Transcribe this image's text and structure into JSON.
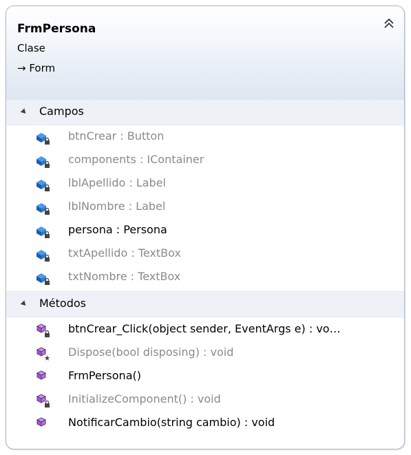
{
  "class_box": {
    "name": "FrmPersona",
    "kind": "Clase",
    "base": "→ Form"
  },
  "fields_section": {
    "label": "Campos",
    "items": [
      {
        "text": "btnCrear : Button",
        "style": "grey"
      },
      {
        "text": "components : IContainer",
        "style": "grey"
      },
      {
        "text": "lblApellido : Label",
        "style": "grey"
      },
      {
        "text": "lblNombre : Label",
        "style": "grey"
      },
      {
        "text": "persona : Persona",
        "style": "dark"
      },
      {
        "text": "txtApellido : TextBox",
        "style": "grey"
      },
      {
        "text": "txtNombre : TextBox",
        "style": "grey"
      }
    ]
  },
  "methods_section": {
    "label": "Métodos",
    "items": [
      {
        "text": "btnCrear_Click(object sender, EventArgs e) : vo…",
        "style": "dark",
        "icon": "method-private-icon"
      },
      {
        "text": "Dispose(bool disposing) : void",
        "style": "grey",
        "icon": "method-protected-icon"
      },
      {
        "text": "FrmPersona()",
        "style": "dark",
        "icon": "method-public-icon"
      },
      {
        "text": "InitializeComponent() : void",
        "style": "grey",
        "icon": "method-private-icon"
      },
      {
        "text": "NotificarCambio(string cambio) : void",
        "style": "dark",
        "icon": "method-public-icon"
      }
    ]
  },
  "colors": {
    "header_gradient_end": "#dde6f2",
    "section_bg": "#eef2f8",
    "field_icon": "#1f6fc5",
    "method_icon": "#7b3fa0",
    "grey_text": "#8a8a8a"
  }
}
